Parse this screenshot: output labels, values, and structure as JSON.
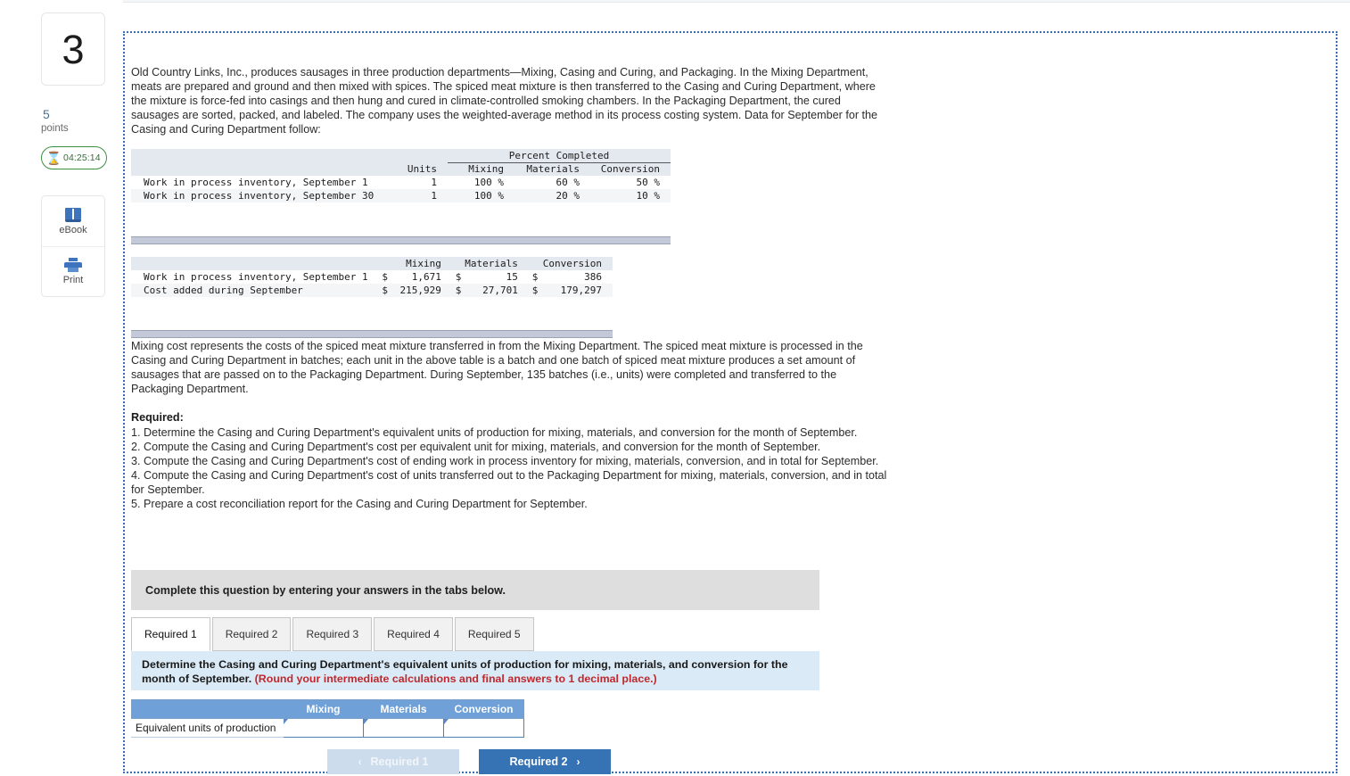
{
  "rail": {
    "question_number": "3",
    "points_value": "5",
    "points_label": "points",
    "timer": "04:25:14",
    "timer_icon": "hourglass-icon",
    "tools": [
      {
        "label": "eBook",
        "icon": "book-icon"
      },
      {
        "label": "Print",
        "icon": "printer-icon"
      }
    ]
  },
  "content": {
    "intro": "Old Country Links, Inc., produces sausages in three production departments—Mixing, Casing and Curing, and Packaging. In the Mixing Department, meats are prepared and ground and then mixed with spices. The spiced meat mixture is then transferred to the Casing and Curing Department, where the mixture is force-fed into casings and then hung and cured in climate-controlled smoking chambers. In the Packaging Department, the cured sausages are sorted, packed, and labeled. The company uses the weighted-average method in its process costing system. Data for September for the Casing and Curing Department follow:",
    "batches_note": "Mixing cost represents the costs of the spiced meat mixture transferred in from the Mixing Department. The spiced meat mixture is processed in the Casing and Curing Department in batches; each unit in the above table is a batch and one batch of spiced meat mixture produces a set amount of sausages that are passed on to the Packaging Department. During September, 135 batches (i.e., units) were completed and transferred to the Packaging Department.",
    "required_heading": "Required:",
    "required_items": [
      "1. Determine the Casing and Curing Department's equivalent units of production for mixing, materials, and conversion for the month of September.",
      "2. Compute the Casing and Curing Department's cost per equivalent unit for mixing, materials, and conversion for the month of September.",
      "3. Compute the Casing and Curing Department's cost of ending work in process inventory for mixing, materials, conversion, and in total for September.",
      "4. Compute the Casing and Curing Department's cost of units transferred out to the Packaging Department for mixing, materials, conversion, and in total for September.",
      "5. Prepare a cost reconciliation report for the Casing and Curing Department for September."
    ]
  },
  "units_table": {
    "group_header": "Percent Completed",
    "columns": [
      "Units",
      "Mixing",
      "Materials",
      "Conversion"
    ],
    "rows": [
      {
        "label": "Work in process inventory, September 1",
        "units": "1",
        "mixing": "100 %",
        "materials": "60 %",
        "conversion": "50 %"
      },
      {
        "label": "Work in process inventory, September 30",
        "units": "1",
        "mixing": "100 %",
        "materials": "20 %",
        "conversion": "10 %"
      }
    ]
  },
  "cost_table": {
    "columns": [
      "Mixing",
      "Materials",
      "Conversion"
    ],
    "rows": [
      {
        "label": "Work in process inventory, September 1",
        "mixing_sym": "$",
        "mixing": "1,671",
        "materials_sym": "$",
        "materials": "15",
        "conversion_sym": "$",
        "conversion": "386"
      },
      {
        "label": "Cost added during September",
        "mixing_sym": "$",
        "mixing": "215,929",
        "materials_sym": "$",
        "materials": "27,701",
        "conversion_sym": "$",
        "conversion": "179,297"
      }
    ]
  },
  "instruction_band": "Complete this question by entering your answers in the tabs below.",
  "tabs": [
    {
      "label": "Required 1",
      "active": true
    },
    {
      "label": "Required 2",
      "active": false
    },
    {
      "label": "Required 3",
      "active": false
    },
    {
      "label": "Required 4",
      "active": false
    },
    {
      "label": "Required 5",
      "active": false
    }
  ],
  "requirement_prompt": {
    "main": "Determine the Casing and Curing Department's equivalent units of production for mixing, materials, and conversion for the month of September. ",
    "note": "(Round your intermediate calculations and final answers to 1 decimal place.)"
  },
  "answer_table": {
    "corner": "",
    "columns": [
      "Mixing",
      "Materials",
      "Conversion"
    ],
    "row_label": "Equivalent units of production",
    "values": [
      "",
      "",
      ""
    ]
  },
  "nav": {
    "prev_label": "Required 1",
    "next_label": "Required 2",
    "prev_chevron": "‹",
    "next_chevron": "›"
  },
  "colors": {
    "panel_border": "#3b6fb5",
    "table_header": "#e4e9f0",
    "table_footer": "#c3c9d8",
    "grey_band": "#dedede",
    "blue_band": "#daeaf6",
    "answer_header": "#6fa0d8",
    "next_button": "#3673b4",
    "prev_button": "#ccdcec",
    "timer_green": "#3f9142",
    "red_note": "#c0282d"
  }
}
